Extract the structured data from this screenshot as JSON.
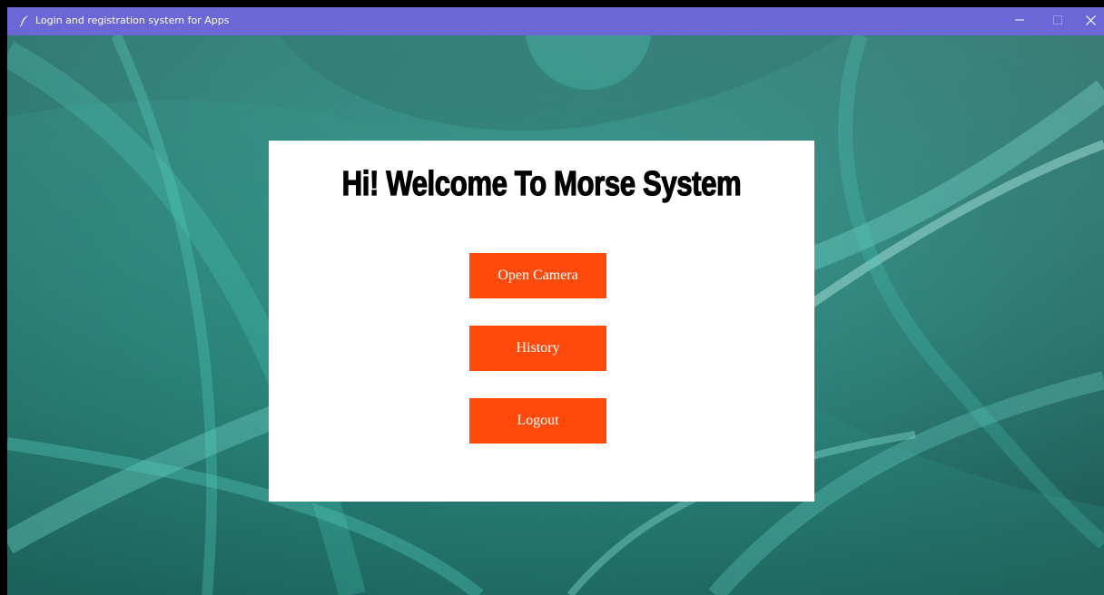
{
  "window": {
    "title": "Login and registration system for Apps",
    "titlebar_color": "#6b67d6"
  },
  "main": {
    "heading": "Hi! Welcome To Morse System",
    "buttons": {
      "open_camera": "Open Camera",
      "history": "History",
      "logout": "Logout"
    },
    "button_color": "#ff4a0c",
    "card_color": "#ffffff"
  },
  "background": {
    "description_colors": [
      "#0f3f3c",
      "#1d6b64",
      "#3fc6b8",
      "#8fe4da"
    ]
  },
  "icons": {
    "app": "feather-icon",
    "minimize": "minimize-icon",
    "maximize": "maximize-icon",
    "close": "close-icon"
  }
}
